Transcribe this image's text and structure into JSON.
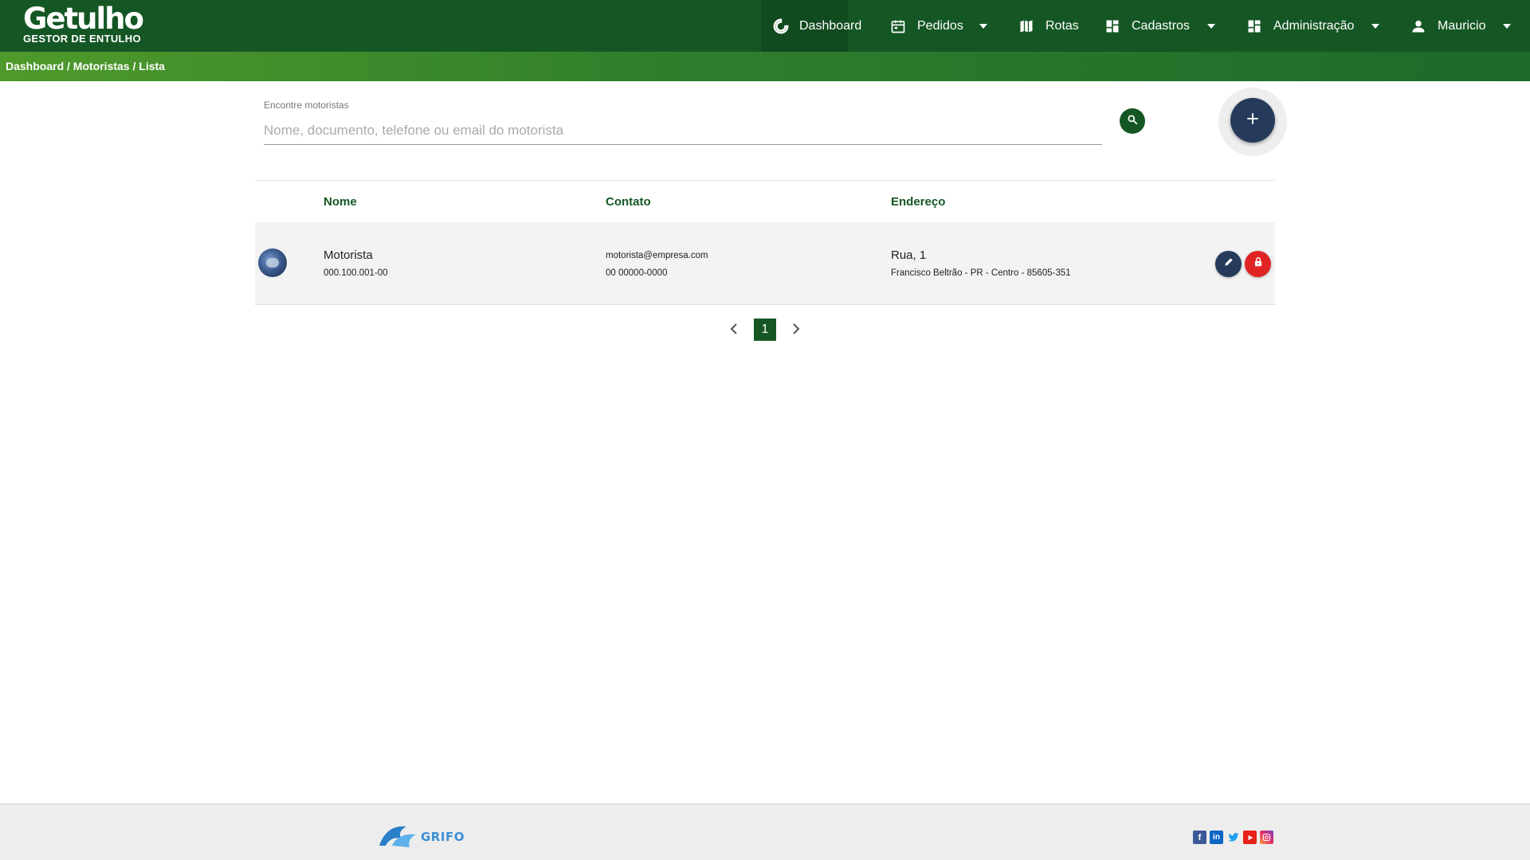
{
  "header": {
    "logo_main": "Getulho",
    "logo_sub": "GESTOR DE ENTULHO",
    "nav": {
      "dashboard": "Dashboard",
      "pedidos": "Pedidos",
      "rotas": "Rotas",
      "cadastros": "Cadastros",
      "administracao": "Administração",
      "user": "Mauricio"
    }
  },
  "breadcrumb": {
    "items": [
      "Dashboard",
      "Motoristas",
      "Lista"
    ],
    "separator": " / "
  },
  "search": {
    "label": "Encontre motoristas",
    "placeholder": "Nome, documento, telefone ou email do motorista",
    "value": ""
  },
  "table": {
    "headers": {
      "nome": "Nome",
      "contato": "Contato",
      "endereco": "Endereço"
    },
    "rows": [
      {
        "name": "Motorista",
        "document": "000.100.001-00",
        "email": "motorista@empresa.com",
        "phone": "00 00000-0000",
        "street": "Rua, 1",
        "city_line": "Francisco Beltrão - PR - Centro - 85605-351"
      }
    ]
  },
  "pagination": {
    "current": "1"
  },
  "footer": {
    "brand": "GRIFO",
    "socials": [
      "facebook-icon",
      "linkedin-icon",
      "twitter-icon",
      "youtube-icon",
      "instagram-icon"
    ]
  },
  "colors": {
    "primary": "#155724",
    "navy": "#263b5c",
    "danger": "#e02424",
    "gradient_start": "#4e9a2b"
  }
}
